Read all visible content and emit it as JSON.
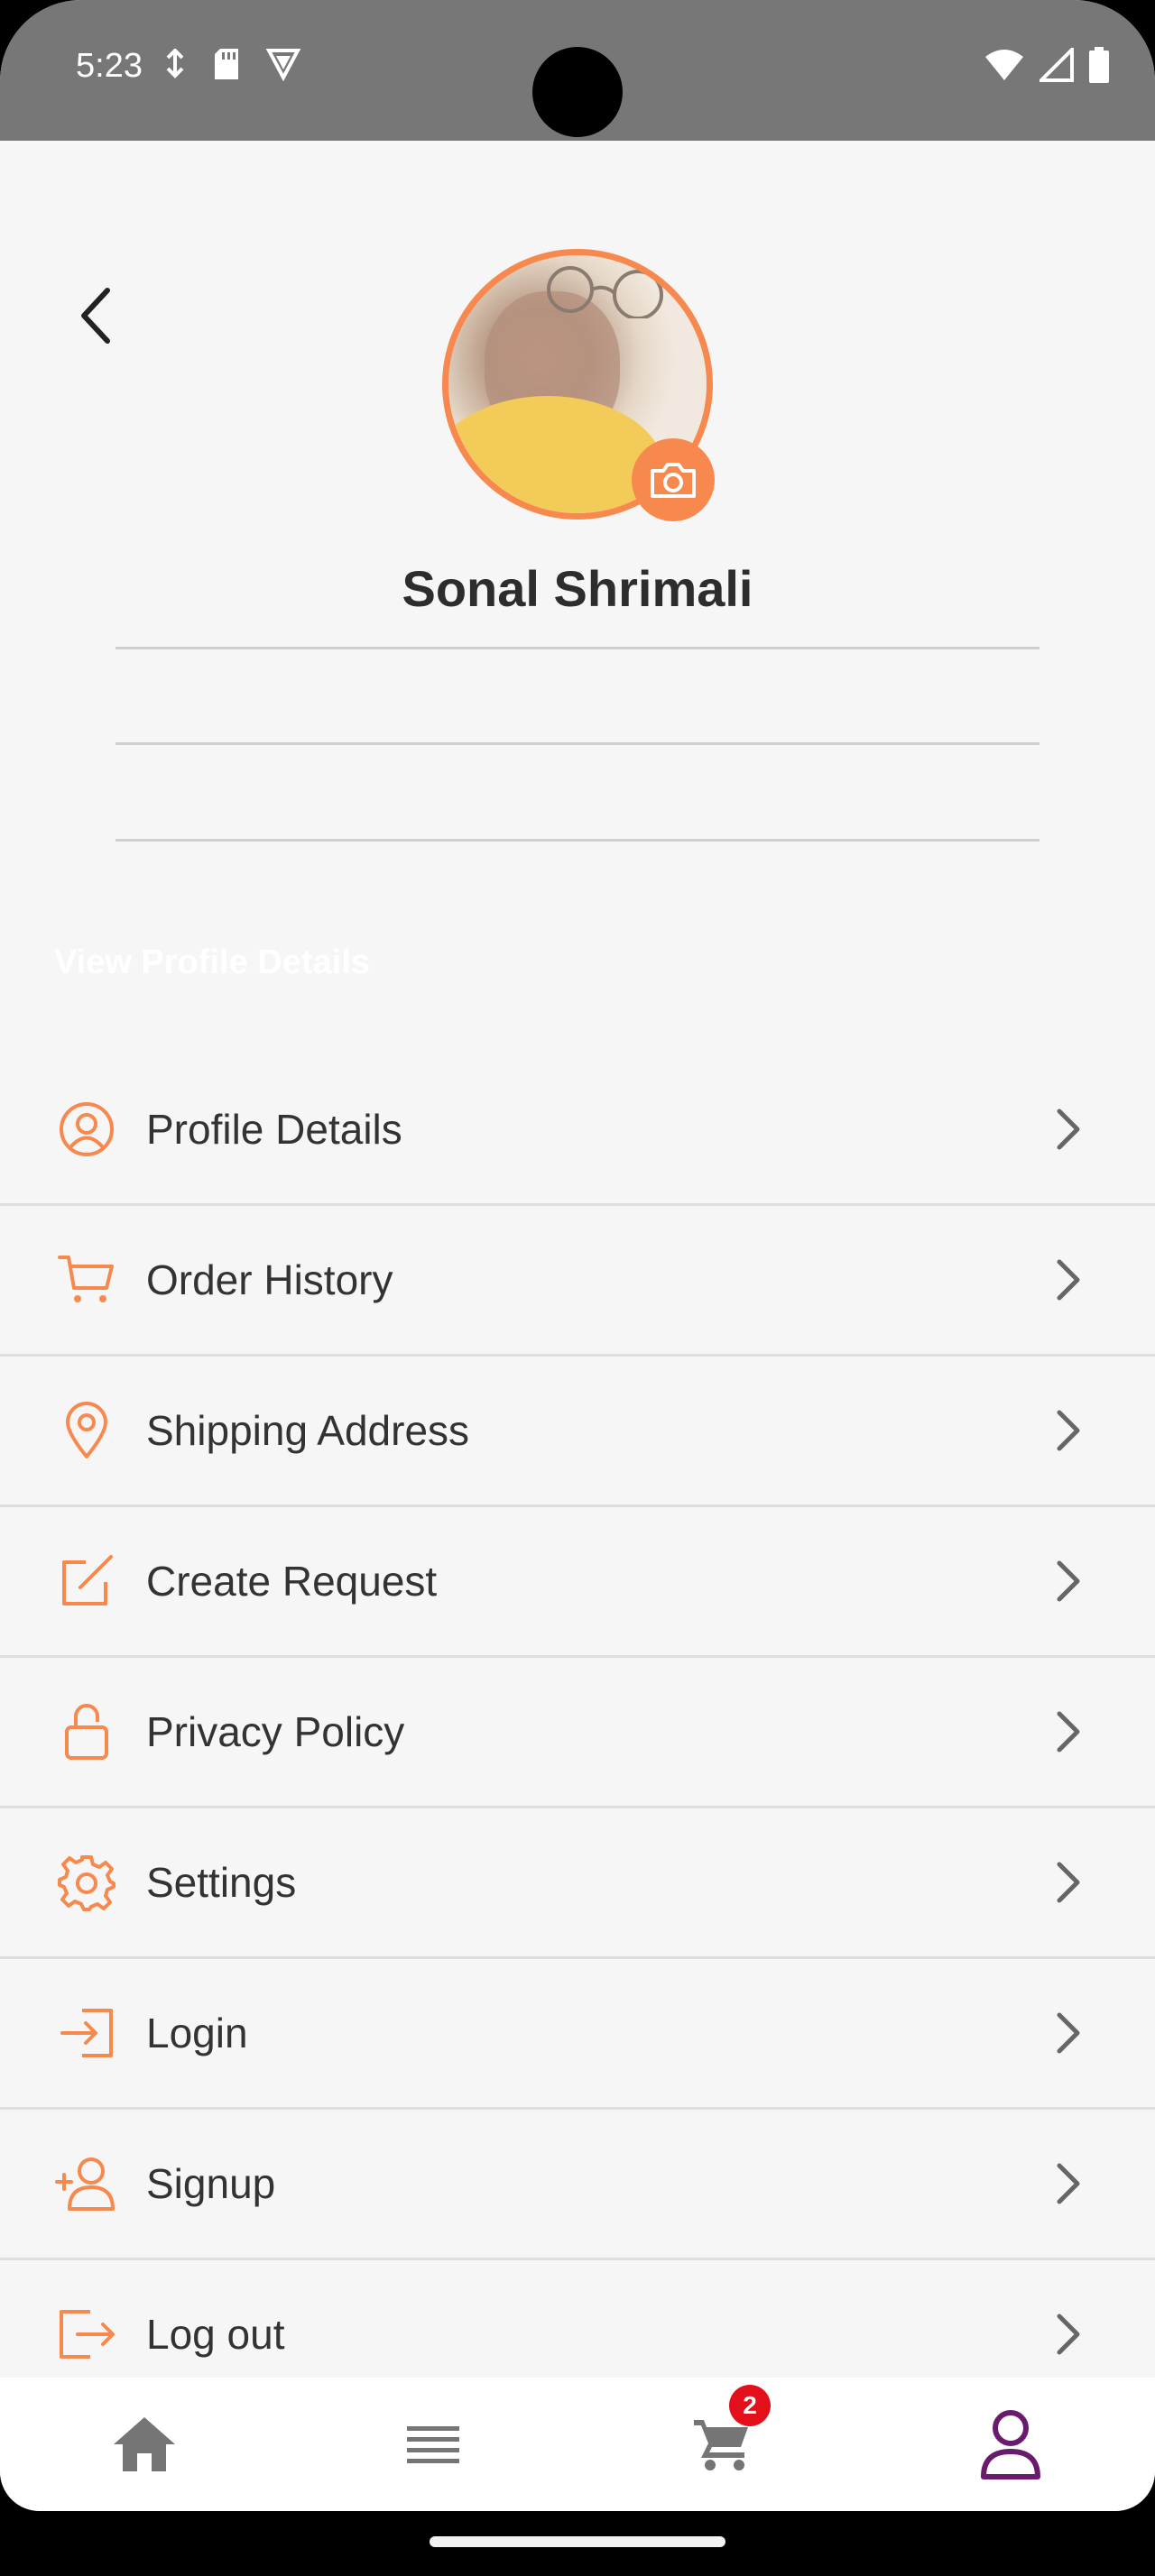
{
  "status_bar": {
    "time": "5:23"
  },
  "profile": {
    "name": "Sonal Shrimali",
    "view_details_label": "View Profile Details"
  },
  "menu": [
    {
      "label": "Profile Details",
      "icon": "user-circle-icon"
    },
    {
      "label": "Order History",
      "icon": "cart-icon"
    },
    {
      "label": "Shipping Address",
      "icon": "location-pin-icon"
    },
    {
      "label": "Create Request",
      "icon": "edit-square-icon"
    },
    {
      "label": "Privacy Policy",
      "icon": "lock-icon"
    },
    {
      "label": "Settings",
      "icon": "gear-icon"
    },
    {
      "label": "Login",
      "icon": "login-icon"
    },
    {
      "label": "Signup",
      "icon": "add-user-icon"
    },
    {
      "label": "Log out",
      "icon": "logout-icon"
    }
  ],
  "bottom_nav": {
    "items": [
      "home-icon",
      "list-icon",
      "cart-icon",
      "profile-icon"
    ],
    "cart_count": "2",
    "active": "profile"
  },
  "colors": {
    "accent": "#f7894e",
    "active_nav": "#6a1b6e",
    "badge": "#e3101c",
    "inactive_nav": "#757575"
  }
}
